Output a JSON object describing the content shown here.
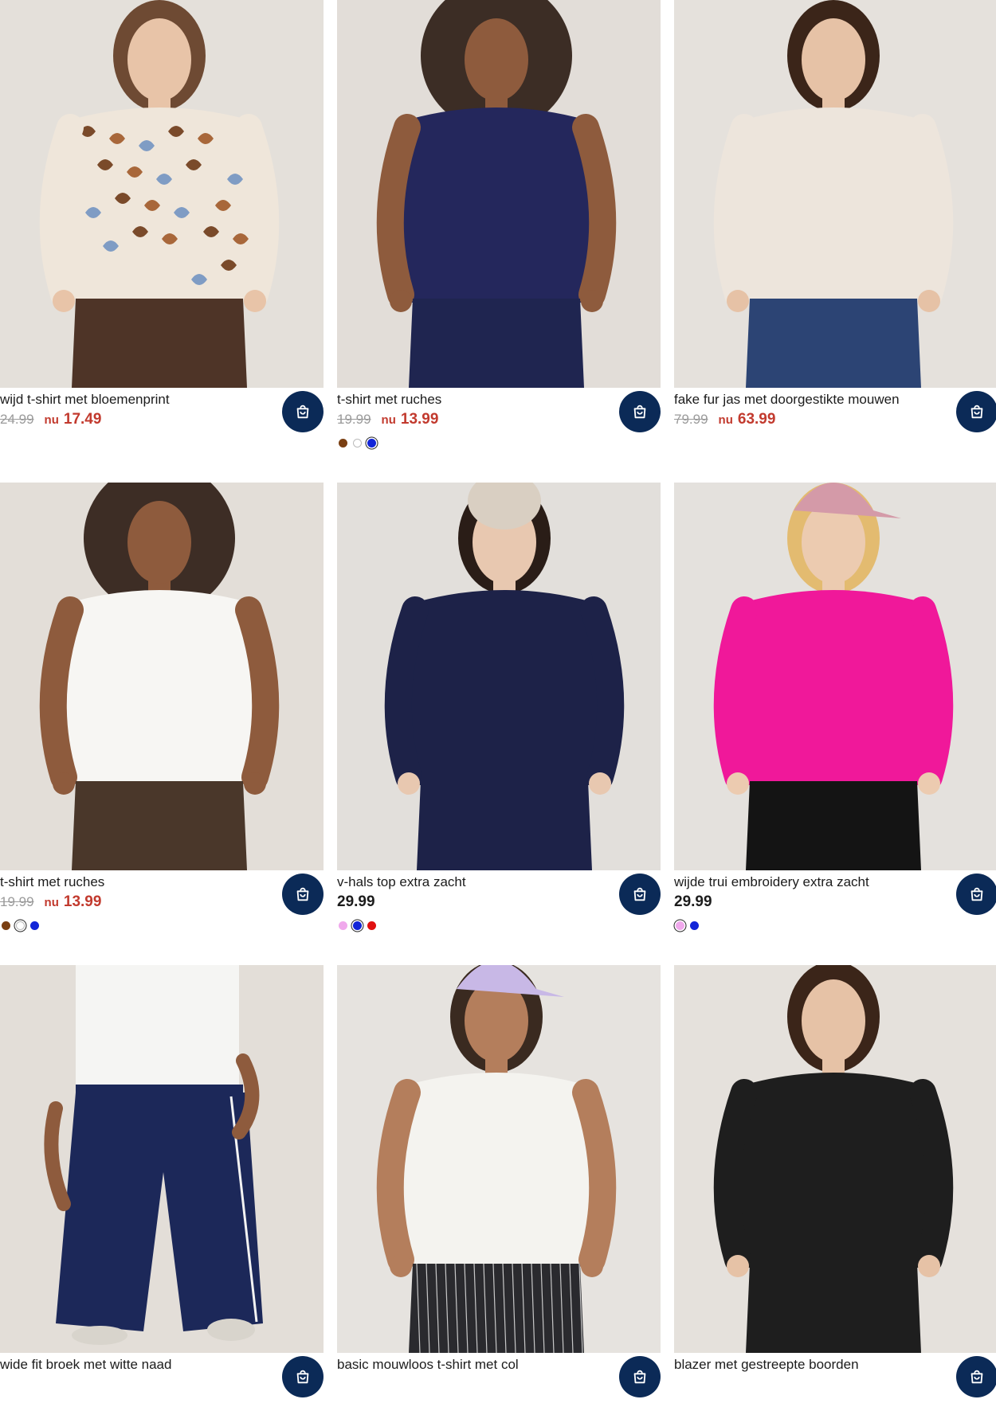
{
  "products": [
    {
      "title": "wijd t-shirt met bloemenprint",
      "old_price": "24.99",
      "nu_label": "nu",
      "price": "17.49",
      "swatches": [],
      "top": "#efe6da",
      "bottom": "#4e3427",
      "bg": "#e4e0da",
      "skin": "#e8c4a8",
      "hair": "#6e4a33",
      "pattern": true
    },
    {
      "title": "t-shirt met ruches",
      "old_price": "19.99",
      "nu_label": "nu",
      "price": "13.99",
      "swatches": [
        {
          "color": "#7a3f12",
          "selected": false
        },
        {
          "color": "#ffffff",
          "selected": false
        },
        {
          "color": "#1225d8",
          "selected": true
        }
      ],
      "top": "#24275c",
      "bottom": "#1f2550",
      "bg": "#e2ddd8",
      "skin": "#8e5b3d",
      "hair": "#2a1a12",
      "pattern": false
    },
    {
      "title": "fake fur jas met doorgestikte mouwen",
      "old_price": "79.99",
      "nu_label": "nu",
      "price": "63.99",
      "swatches": [],
      "top": "#ede5dc",
      "bottom": "#2c4474",
      "bg": "#e5e1dc",
      "skin": "#e6c2a6",
      "hair": "#3b2519",
      "pattern": false
    },
    {
      "title": "t-shirt met ruches",
      "old_price": "19.99",
      "nu_label": "nu",
      "price": "13.99",
      "swatches": [
        {
          "color": "#7a3f12",
          "selected": false
        },
        {
          "color": "#ffffff",
          "selected": true
        },
        {
          "color": "#1225d8",
          "selected": false
        }
      ],
      "top": "#f7f6f3",
      "bottom": "#4a372a",
      "bg": "#e3ded8",
      "skin": "#8e5b3d",
      "hair": "#2a1a12",
      "pattern": false
    },
    {
      "title": "v-hals top extra zacht",
      "old_price": "",
      "nu_label": "",
      "price": "29.99",
      "swatches": [
        {
          "color": "#f0a8ec",
          "selected": false
        },
        {
          "color": "#1225d8",
          "selected": true
        },
        {
          "color": "#e01010",
          "selected": false
        }
      ],
      "top": "#1d2248",
      "bottom": "#1d2248",
      "bg": "#e2dfdb",
      "skin": "#e8c8b0",
      "hair": "#2a1d17",
      "pattern": false
    },
    {
      "title": "wijde trui embroidery extra zacht",
      "old_price": "",
      "nu_label": "",
      "price": "29.99",
      "swatches": [
        {
          "color": "#f0a8ec",
          "selected": true
        },
        {
          "color": "#1225d8",
          "selected": false
        }
      ],
      "top": "#f0189a",
      "bottom": "#141414",
      "bg": "#e4e1dd",
      "skin": "#eccbb0",
      "hair": "#e3bb70",
      "pattern": false
    },
    {
      "title": "wide fit broek met witte naad",
      "old_price": "",
      "nu_label": "",
      "price": "",
      "swatches": [],
      "top": "#f5f5f3",
      "bottom": "#1c2859",
      "bg": "#e3ded8",
      "skin": "#8e5b3d",
      "hair": "#2a1a12",
      "pattern": false
    },
    {
      "title": "basic mouwloos t-shirt met col",
      "old_price": "",
      "nu_label": "",
      "price": "",
      "swatches": [],
      "top": "#f4f3ef",
      "bottom": "#2a2a2e",
      "bg": "#e6e3df",
      "skin": "#b47e5c",
      "hair": "#3a2a20",
      "pattern": false
    },
    {
      "title": "blazer met gestreepte boorden",
      "old_price": "",
      "nu_label": "",
      "price": "",
      "swatches": [],
      "top": "#1e1e1e",
      "bottom": "#1e1e1e",
      "bg": "#e5e1dc",
      "skin": "#e6c2a6",
      "hair": "#3b2519",
      "pattern": false
    }
  ],
  "colors": {
    "cart_button": "#0b2a57",
    "sale": "#c23a2e"
  },
  "icons": {
    "cart": "shopping-bag-icon"
  }
}
